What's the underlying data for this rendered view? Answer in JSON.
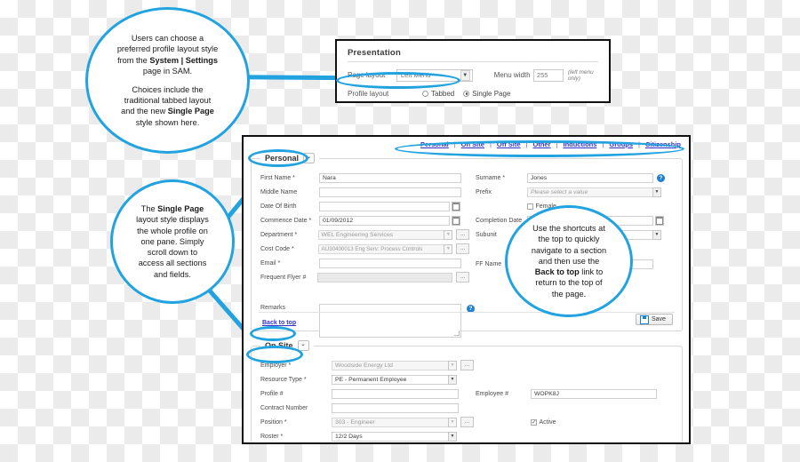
{
  "callouts": [
    {
      "id": "callout-settings",
      "lines": [
        {
          "runs": [
            {
              "t": "Users can choose a",
              "b": false
            }
          ]
        },
        {
          "runs": [
            {
              "t": "preferred profile layout style",
              "b": false
            }
          ]
        },
        {
          "runs": [
            {
              "t": "from the ",
              "b": false
            },
            {
              "t": "System | Settings",
              "b": true
            }
          ]
        },
        {
          "runs": [
            {
              "t": "page in SAM.",
              "b": false
            }
          ]
        },
        {
          "gap": true
        },
        {
          "runs": [
            {
              "t": "Choices include the",
              "b": false
            }
          ]
        },
        {
          "runs": [
            {
              "t": "traditional tabbed layout",
              "b": false
            }
          ]
        },
        {
          "runs": [
            {
              "t": "and the new ",
              "b": false
            },
            {
              "t": "Single Page",
              "b": true
            }
          ]
        },
        {
          "runs": [
            {
              "t": "style shown here.",
              "b": false
            }
          ]
        }
      ]
    },
    {
      "id": "callout-singlepage",
      "lines": [
        {
          "runs": [
            {
              "t": "The ",
              "b": false
            },
            {
              "t": "Single Page",
              "b": true
            }
          ]
        },
        {
          "runs": [
            {
              "t": "layout style displays",
              "b": false
            }
          ]
        },
        {
          "runs": [
            {
              "t": "the whole profile on",
              "b": false
            }
          ]
        },
        {
          "runs": [
            {
              "t": "one pane.  Simply",
              "b": false
            }
          ]
        },
        {
          "runs": [
            {
              "t": "scroll down to",
              "b": false
            }
          ]
        },
        {
          "runs": [
            {
              "t": "access all sections",
              "b": false
            }
          ]
        },
        {
          "runs": [
            {
              "t": "and fields.",
              "b": false
            }
          ]
        }
      ]
    },
    {
      "id": "callout-shortcuts",
      "lines": [
        {
          "runs": [
            {
              "t": "Use the shortcuts at",
              "b": false
            }
          ]
        },
        {
          "runs": [
            {
              "t": "the top to quickly",
              "b": false
            }
          ]
        },
        {
          "runs": [
            {
              "t": "navigate to a section",
              "b": false
            }
          ]
        },
        {
          "runs": [
            {
              "t": "and then use the",
              "b": false
            }
          ]
        },
        {
          "runs": [
            {
              "t": "Back to top",
              "b": true
            },
            {
              "t": " link to",
              "b": false
            }
          ]
        },
        {
          "runs": [
            {
              "t": "return to the top of",
              "b": false
            }
          ]
        },
        {
          "runs": [
            {
              "t": "the page.",
              "b": false
            }
          ]
        }
      ]
    }
  ],
  "presentation": {
    "title": "Presentation",
    "page_layout_label": "Page layout",
    "page_layout_value": "Left Menu",
    "menu_width_label": "Menu width",
    "menu_width_value": "255",
    "menu_width_note": "(left menu only)",
    "profile_layout_label": "Profile layout",
    "options": [
      {
        "label": "Tabbed",
        "selected": false
      },
      {
        "label": "Single Page",
        "selected": true
      }
    ]
  },
  "app": {
    "nav_links": [
      "Personal",
      "On Site",
      "Off Site",
      "Other",
      "Inductions",
      "Groups",
      "Citizenship"
    ],
    "nav_separator": "|",
    "back_to_top": "Back to top",
    "save_label": "Save",
    "personal": {
      "legend": "Personal",
      "left_fields": [
        {
          "label": "First Name *",
          "value": "Nara",
          "type": "text"
        },
        {
          "label": "Middle Name",
          "value": "",
          "type": "text"
        },
        {
          "label": "Date Of Birth",
          "value": "",
          "type": "date"
        },
        {
          "label": "Commence Date *",
          "value": "01/09/2012",
          "type": "date"
        },
        {
          "label": "Department *",
          "value": "WEL Engineering Services",
          "type": "select-ell",
          "disabled": true
        },
        {
          "label": "Cost Code *",
          "value": "AU30400013 Eng Serv: Process Controls",
          "type": "select-ell",
          "disabled": true
        },
        {
          "label": "Email *",
          "value": "",
          "type": "text"
        },
        {
          "label": "Frequent Flyer #",
          "value": "",
          "type": "grey-ell"
        }
      ],
      "right_fields": [
        {
          "label": "Surname *",
          "value": "Jones",
          "type": "text-help"
        },
        {
          "label": "Prefix",
          "value": "Please select a value",
          "type": "select",
          "placeholder": true
        },
        {
          "label": "",
          "value": "Female",
          "type": "checkbox",
          "checked": false
        },
        {
          "label": "Completion Date",
          "value": "",
          "type": "date"
        },
        {
          "label": "Subunit",
          "value": "",
          "type": "select"
        },
        {
          "label": "FF Name",
          "value": "",
          "type": "text"
        }
      ],
      "remarks_label": "Remarks"
    },
    "onsite": {
      "legend": "On Site",
      "left_fields": [
        {
          "label": "Employer *",
          "value": "Woodside Energy Ltd",
          "type": "select-ell",
          "disabled": true
        },
        {
          "label": "Resource Type *",
          "value": "PE - Permanent Employee",
          "type": "select"
        },
        {
          "label": "Profile #",
          "value": "",
          "type": "text"
        },
        {
          "label": "Contract Number",
          "value": "",
          "type": "text"
        },
        {
          "label": "Position *",
          "value": "303 - Engineer",
          "type": "select-ell",
          "disabled": true
        },
        {
          "label": "Roster *",
          "value": "12/2 Days",
          "type": "select"
        }
      ],
      "right_fields": [
        {
          "label": "Employee #",
          "value": "WOPK8J",
          "type": "text"
        },
        {
          "label": "",
          "value": "Active",
          "type": "checkbox",
          "checked": true
        }
      ]
    }
  },
  "colors": {
    "accent_blue": "#22a3e0",
    "link_blue": "#3333cc",
    "help_blue": "#1f7fd0",
    "frame_black": "#111111"
  }
}
